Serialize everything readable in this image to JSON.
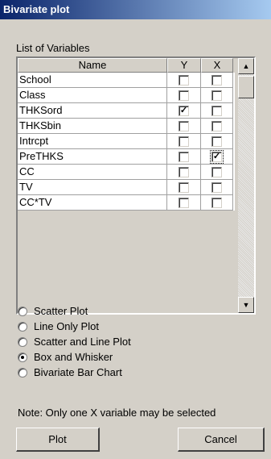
{
  "window": {
    "title": "Bivariate plot"
  },
  "list": {
    "label": "List of Variables",
    "headers": {
      "name": "Name",
      "y": "Y",
      "x": "X"
    },
    "rows": [
      {
        "name": "School",
        "y": "",
        "x": ""
      },
      {
        "name": "Class",
        "y": "",
        "x": ""
      },
      {
        "name": "THKSord",
        "y": "✓",
        "x": ""
      },
      {
        "name": "THKSbin",
        "y": "",
        "x": ""
      },
      {
        "name": "Intrcpt",
        "y": "",
        "x": ""
      },
      {
        "name": "PreTHKS",
        "y": "",
        "x": "✓"
      },
      {
        "name": "CC",
        "y": "",
        "x": ""
      },
      {
        "name": "TV",
        "y": "",
        "x": ""
      },
      {
        "name": "CC*TV",
        "y": "",
        "x": ""
      }
    ],
    "scroll_up_icon": "▲",
    "scroll_down_icon": "▼"
  },
  "plot_types": [
    {
      "label": "Scatter Plot",
      "selected": false
    },
    {
      "label": "Line Only Plot",
      "selected": false
    },
    {
      "label": "Scatter and Line Plot",
      "selected": false
    },
    {
      "label": "Box and Whisker",
      "selected": true
    },
    {
      "label": "Bivariate Bar Chart",
      "selected": false
    }
  ],
  "note": "Note: Only one X variable may be selected",
  "buttons": {
    "plot": "Plot",
    "cancel": "Cancel"
  }
}
